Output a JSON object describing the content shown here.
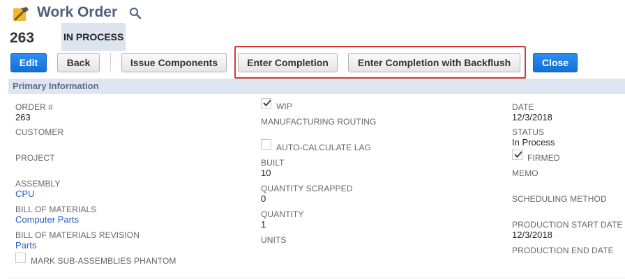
{
  "header": {
    "title": "Work Order",
    "record_number": "263",
    "status": "IN PROCESS"
  },
  "toolbar": {
    "edit": "Edit",
    "back": "Back",
    "issue_components": "Issue Components",
    "enter_completion": "Enter Completion",
    "enter_completion_backflush": "Enter Completion with Backflush",
    "close": "Close"
  },
  "section": {
    "title": "Primary Information"
  },
  "fields": {
    "order_label": "ORDER #",
    "order_value": "263",
    "customer_label": "CUSTOMER",
    "project_label": "PROJECT",
    "assembly_label": "ASSEMBLY",
    "assembly_value": "CPU",
    "bom_label": "BILL OF MATERIALS",
    "bom_value": "Computer Parts",
    "bom_rev_label": "BILL OF MATERIALS REVISION",
    "bom_rev_value": "Parts",
    "phantom_label": "MARK SUB-ASSEMBLIES PHANTOM",
    "wip_label": "WIP",
    "routing_label": "MANUFACTURING ROUTING",
    "autocalc_label": "AUTO-CALCULATE LAG",
    "built_label": "BUILT",
    "built_value": "10",
    "scrapped_label": "QUANTITY SCRAPPED",
    "scrapped_value": "0",
    "quantity_label": "QUANTITY",
    "quantity_value": "1",
    "units_label": "UNITS",
    "date_label": "DATE",
    "date_value": "12/3/2018",
    "status_label": "STATUS",
    "status_value": "In Process",
    "firmed_label": "FIRMED",
    "memo_label": "MEMO",
    "scheduling_label": "SCHEDULING METHOD",
    "prod_start_label": "PRODUCTION START DATE",
    "prod_start_value": "12/3/2018",
    "prod_end_label": "PRODUCTION END DATE"
  },
  "checkboxes": {
    "wip": true,
    "autocalc": false,
    "firmed": true,
    "phantom": false
  },
  "colors": {
    "primary_button": "#1a7de6",
    "highlight_border": "#d9343a",
    "section_bar": "#dfe6ef",
    "link": "#245dc1"
  },
  "icons": {
    "record_type": "hammer-wrench-icon",
    "search": "search-icon"
  }
}
